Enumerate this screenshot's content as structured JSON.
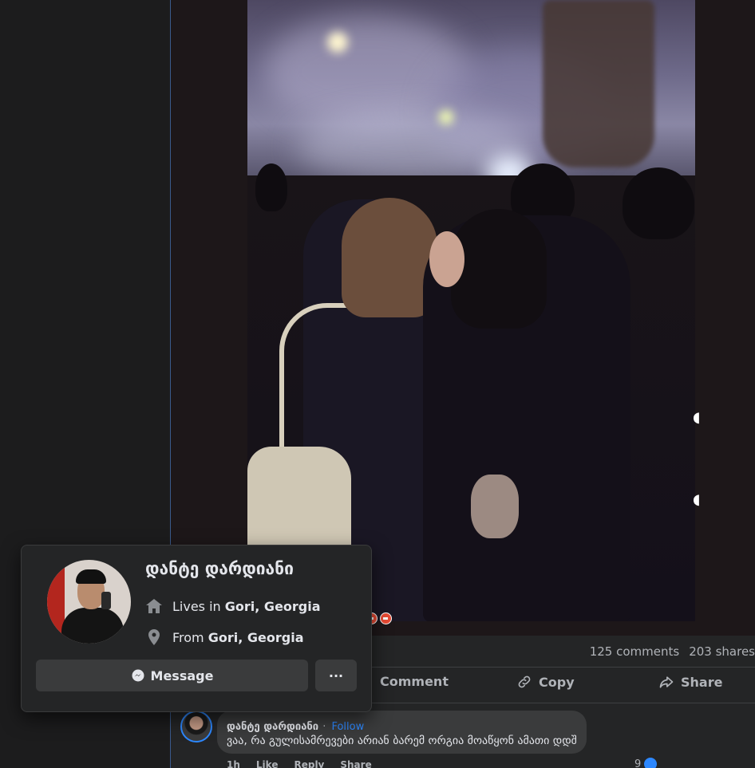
{
  "post": {
    "stats": {
      "comments": "125 comments",
      "shares": "203 shares"
    },
    "actions": {
      "comment": "Comment",
      "copy": "Copy",
      "share": "Share"
    }
  },
  "comment": {
    "author": "დანტე დარდიანი",
    "separator": "·",
    "follow": "Follow",
    "text": "ვაა, რა გულისამრევები არიან ბარემ ორგია მოაწყონ ამათი დდშ",
    "time": "1h",
    "like": "Like",
    "reply": "Reply",
    "share": "Share",
    "like_count": "9"
  },
  "hovercard": {
    "name": "დანტე დარდიანი",
    "lives_prefix": "Lives in",
    "lives_place": "Gori, Georgia",
    "from_prefix": "From",
    "from_place": "Gori, Georgia",
    "message_label": "Message",
    "more_label": "···"
  },
  "icons": {
    "home": "home-icon",
    "location": "location-pin-icon",
    "messenger": "messenger-icon",
    "comment": "comment-icon",
    "copy": "link-icon",
    "share": "share-arrow-icon"
  },
  "colors": {
    "accent": "#2d88ff",
    "reaction": "#e94b35",
    "card": "#242526",
    "button": "#3a3b3c"
  }
}
